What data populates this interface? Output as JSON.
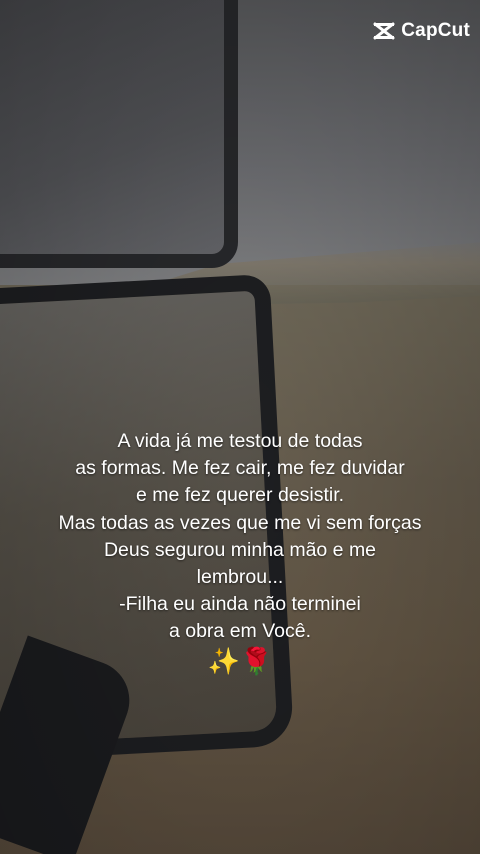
{
  "brand": {
    "name": "CapCut",
    "icon": "capcut-logo-icon"
  },
  "caption": {
    "lines": [
      "A vida já me testou de todas",
      "as formas. Me fez cair, me fez duvidar",
      "e me fez querer desistir.",
      "Mas todas as vezes que me vi sem forças",
      "Deus segurou minha mão e me",
      "lembrou...",
      "-Filha eu ainda não terminei",
      "a obra em Você."
    ]
  },
  "emojis": "✨🌹",
  "colors": {
    "text": "#ffffff",
    "mirror_frame": "#1f2023"
  }
}
